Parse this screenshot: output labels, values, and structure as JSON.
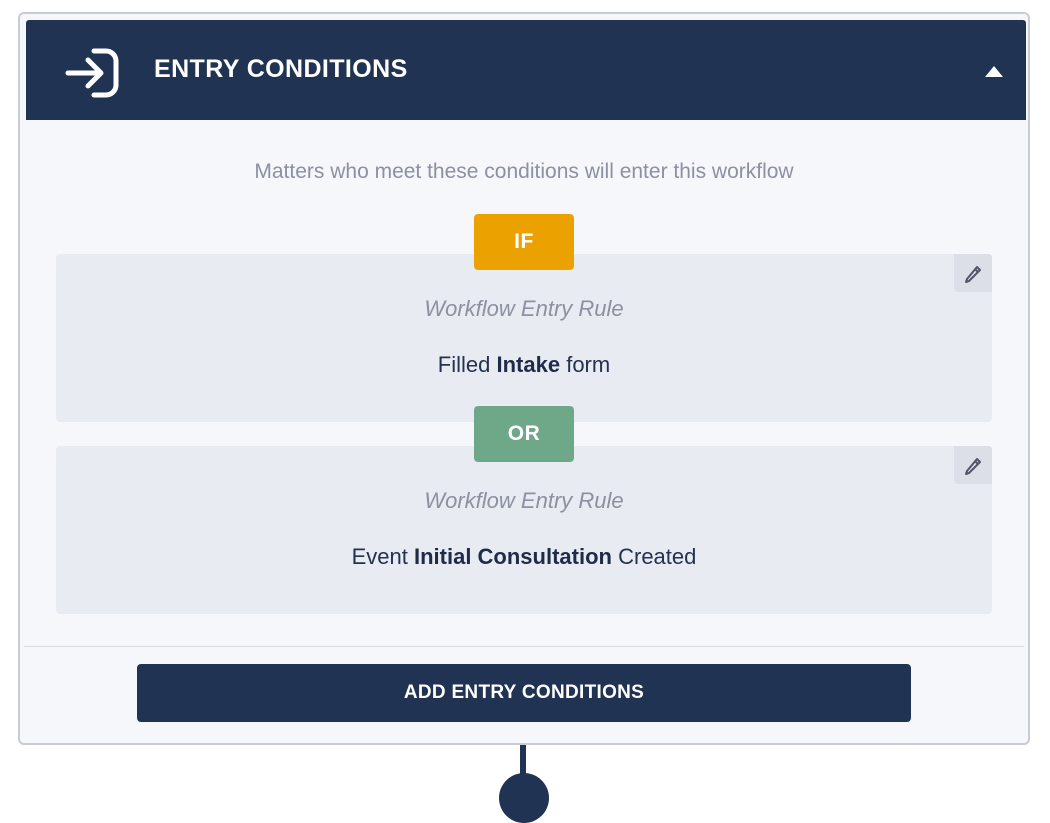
{
  "header": {
    "title": "ENTRY CONDITIONS",
    "icon": "entry-arrow-icon",
    "collapse_icon": "caret-up-icon"
  },
  "subtitle": "Matters who meet these conditions will enter this workflow",
  "operators": {
    "first": "IF",
    "second": "OR"
  },
  "rules": [
    {
      "label": "Workflow Entry Rule",
      "prefix": "Filled",
      "highlight": "Intake",
      "suffix": "form"
    },
    {
      "label": "Workflow Entry Rule",
      "prefix": "Event",
      "highlight": "Initial Consultation",
      "suffix": "Created"
    }
  ],
  "add_button_label": "ADD ENTRY CONDITIONS",
  "colors": {
    "navy": "#213352",
    "if_pill": "#eba200",
    "or_pill": "#6ea889",
    "rule_bg": "#e9ebf2"
  }
}
